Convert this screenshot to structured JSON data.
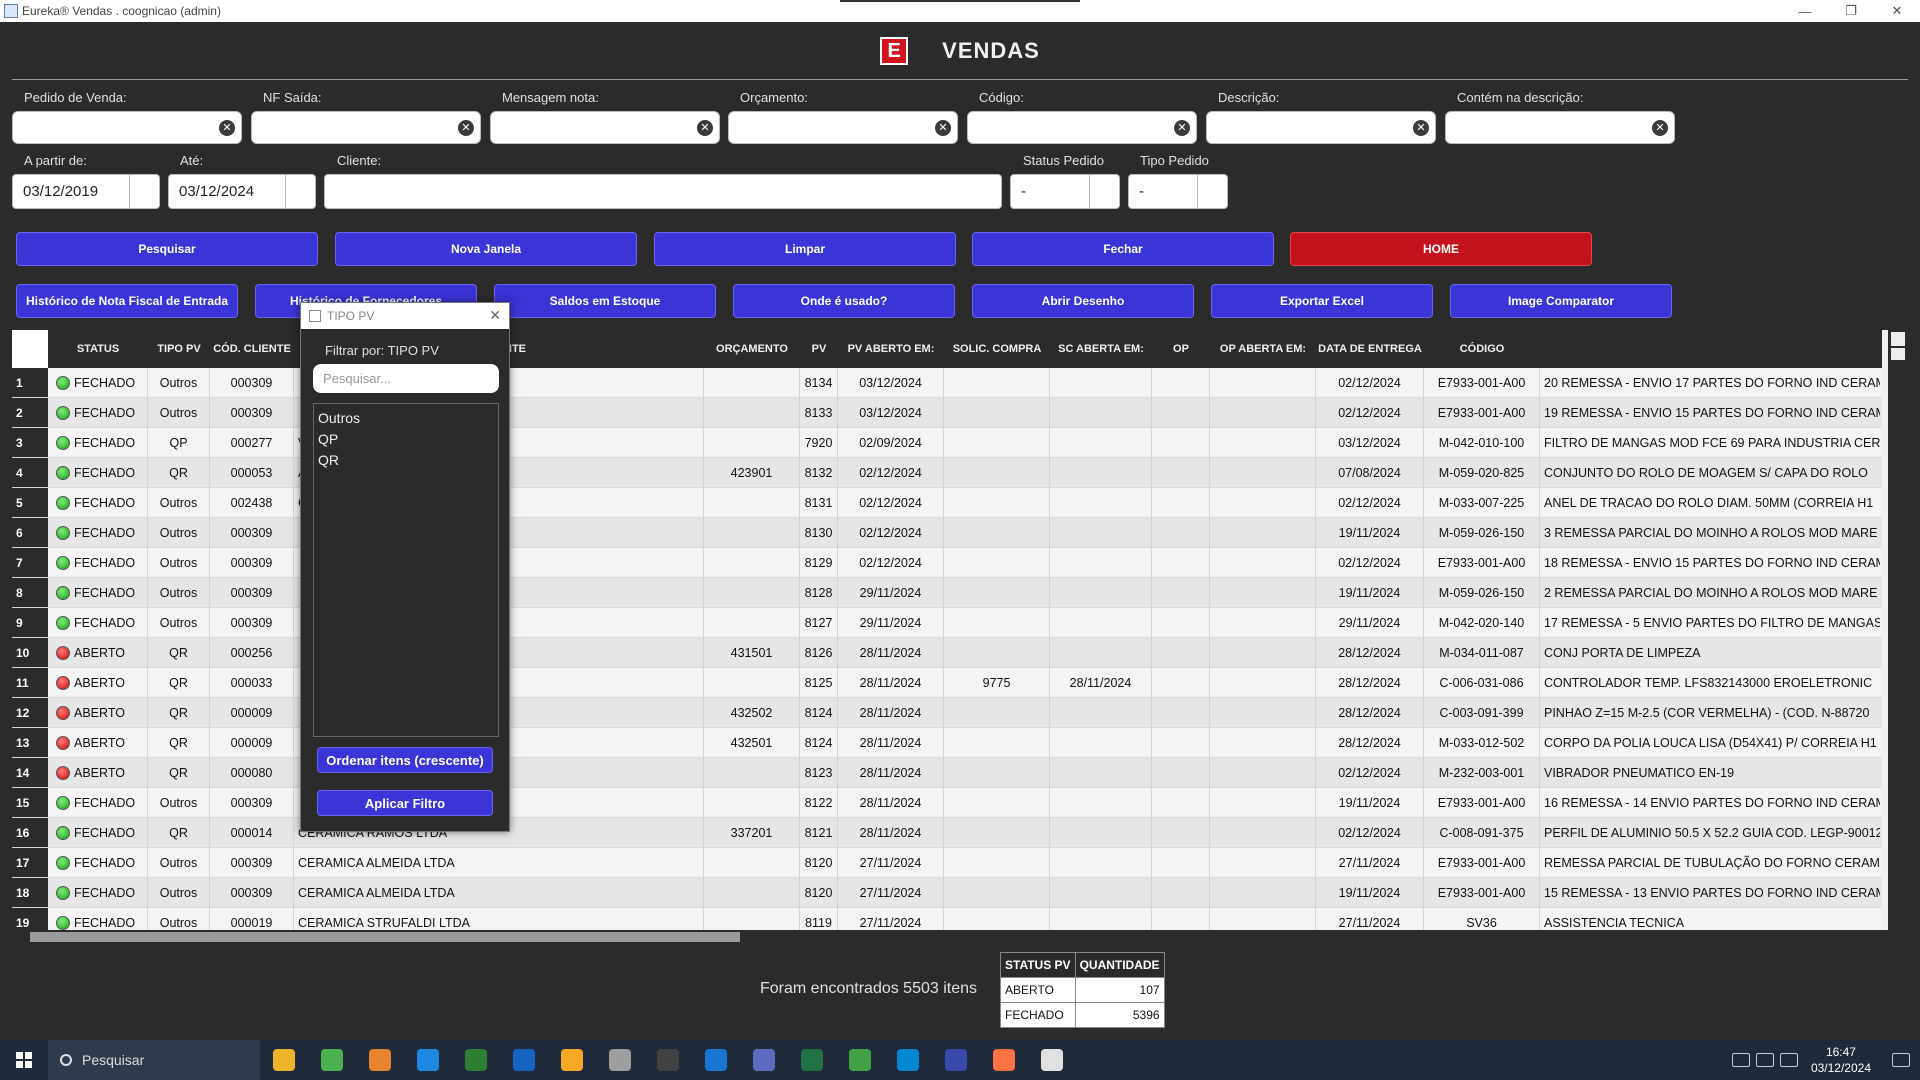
{
  "window": {
    "title": "Eureka® Vendas . coognicao (admin)",
    "minimize": "—",
    "restore": "❐",
    "close": "✕"
  },
  "header": {
    "logo": "E",
    "title": "VENDAS"
  },
  "filters": {
    "pedido_venda": "Pedido de Venda:",
    "nf_saida": "NF Saída:",
    "mensagem_nota": "Mensagem nota:",
    "orcamento": "Orçamento:",
    "codigo": "Código:",
    "descricao": "Descrição:",
    "contem_descricao": "Contém na descrição:",
    "a_partir_de": "A partir de:",
    "ate": "Até:",
    "cliente": "Cliente:",
    "status_pedido": "Status Pedido",
    "tipo_pedido": "Tipo Pedido",
    "date_from": "03/12/2019",
    "date_to": "03/12/2024",
    "status_value": "-",
    "tipo_value": "-"
  },
  "buttons": {
    "pesquisar": "Pesquisar",
    "nova_janela": "Nova Janela",
    "limpar": "Limpar",
    "fechar": "Fechar",
    "home": "HOME",
    "historico_nf": "Histórico de Nota Fiscal de Entrada",
    "historico_fornecedores": "Histórico de Fornecedores",
    "saldos": "Saldos em Estoque",
    "onde_usado": "Onde é usado?",
    "abrir_desenho": "Abrir Desenho",
    "exportar_excel": "Exportar Excel",
    "image_comparator": "Image Comparator"
  },
  "table": {
    "headers": {
      "status": "STATUS",
      "tipo_pv": "TIPO PV",
      "cod_cliente": "CÓD. CLIENTE",
      "cliente": "NTE",
      "orcamento": "ORÇAMENTO",
      "pv": "PV",
      "pv_aberto": "PV ABERTO EM:",
      "solic_compra": "SOLIC. COMPRA",
      "sc_aberta": "SC ABERTA EM:",
      "op": "OP",
      "op_aberta": "OP ABERTA EM:",
      "data_entrega": "DATA DE ENTREGA",
      "codigo": "CÓDIGO"
    },
    "rows": [
      {
        "n": "1",
        "status": "FECHADO",
        "color": "green",
        "tipo": "Outros",
        "cod": "000309",
        "cliente": "",
        "orc": "",
        "pv": "8134",
        "pvdate": "03/12/2024",
        "sc": "",
        "scdate": "",
        "op": "",
        "opdate": "",
        "entrega": "02/12/2024",
        "codigo": "E7933-001-A00",
        "desc": "20 REMESSA - ENVIO 17 PARTES DO FORNO IND CERAMICO"
      },
      {
        "n": "2",
        "status": "FECHADO",
        "color": "green",
        "tipo": "Outros",
        "cod": "000309",
        "cliente": "",
        "orc": "",
        "pv": "8133",
        "pvdate": "03/12/2024",
        "sc": "",
        "scdate": "",
        "op": "",
        "opdate": "",
        "entrega": "02/12/2024",
        "codigo": "E7933-001-A00",
        "desc": "19 REMESSA - ENVIO 15 PARTES DO FORNO IND CERAMICO"
      },
      {
        "n": "3",
        "status": "FECHADO",
        "color": "green",
        "tipo": "QP",
        "cod": "000277",
        "cliente": "VINILICOS LTDA",
        "orc": "",
        "pv": "7920",
        "pvdate": "02/09/2024",
        "sc": "",
        "scdate": "",
        "op": "",
        "opdate": "",
        "entrega": "03/12/2024",
        "codigo": "M-042-010-100",
        "desc": "FILTRO DE MANGAS MOD FCE 69 PARA INDUSTRIA CERAMICA"
      },
      {
        "n": "4",
        "status": "FECHADO",
        "color": "green",
        "tipo": "QR",
        "cod": "000053",
        "cliente": "AMICOS LTDA.",
        "orc": "423901",
        "pv": "8132",
        "pvdate": "02/12/2024",
        "sc": "",
        "scdate": "",
        "op": "",
        "opdate": "",
        "entrega": "07/08/2024",
        "codigo": "M-059-020-825",
        "desc": "CONJUNTO DO ROLO DE MOAGEM S/ CAPA DO ROLO"
      },
      {
        "n": "5",
        "status": "FECHADO",
        "color": "green",
        "tipo": "Outros",
        "cod": "002438",
        "cliente": "CO DE METAIS",
        "orc": "",
        "pv": "8131",
        "pvdate": "02/12/2024",
        "sc": "",
        "scdate": "",
        "op": "",
        "opdate": "",
        "entrega": "02/12/2024",
        "codigo": "M-033-007-225",
        "desc": "ANEL DE TRACAO DO ROLO DIAM. 50MM (CORREIA H1"
      },
      {
        "n": "6",
        "status": "FECHADO",
        "color": "green",
        "tipo": "Outros",
        "cod": "000309",
        "cliente": "",
        "orc": "",
        "pv": "8130",
        "pvdate": "02/12/2024",
        "sc": "",
        "scdate": "",
        "op": "",
        "opdate": "",
        "entrega": "19/11/2024",
        "codigo": "M-059-026-150",
        "desc": "3 REMESSA PARCIAL DO MOINHO A ROLOS MOD MARE"
      },
      {
        "n": "7",
        "status": "FECHADO",
        "color": "green",
        "tipo": "Outros",
        "cod": "000309",
        "cliente": "",
        "orc": "",
        "pv": "8129",
        "pvdate": "02/12/2024",
        "sc": "",
        "scdate": "",
        "op": "",
        "opdate": "",
        "entrega": "02/12/2024",
        "codigo": "E7933-001-A00",
        "desc": "18 REMESSA - ENVIO 15 PARTES DO FORNO IND CERAMICO"
      },
      {
        "n": "8",
        "status": "FECHADO",
        "color": "green",
        "tipo": "Outros",
        "cod": "000309",
        "cliente": "",
        "orc": "",
        "pv": "8128",
        "pvdate": "29/11/2024",
        "sc": "",
        "scdate": "",
        "op": "",
        "opdate": "",
        "entrega": "19/11/2024",
        "codigo": "M-059-026-150",
        "desc": "2 REMESSA PARCIAL DO MOINHO A ROLOS MOD MARE"
      },
      {
        "n": "9",
        "status": "FECHADO",
        "color": "green",
        "tipo": "Outros",
        "cod": "000309",
        "cliente": "",
        "orc": "",
        "pv": "8127",
        "pvdate": "29/11/2024",
        "sc": "",
        "scdate": "",
        "op": "",
        "opdate": "",
        "entrega": "29/11/2024",
        "codigo": "M-042-020-140",
        "desc": "17 REMESSA - 5 ENVIO PARTES DO FILTRO DE MANGAS"
      },
      {
        "n": "10",
        "status": "ABERTO",
        "color": "red",
        "tipo": "QR",
        "cod": "000256",
        "cliente": "",
        "orc": "431501",
        "pv": "8126",
        "pvdate": "28/11/2024",
        "sc": "",
        "scdate": "",
        "op": "",
        "opdate": "",
        "entrega": "28/12/2024",
        "codigo": "M-034-011-087",
        "desc": "CONJ PORTA DE LIMPEZA"
      },
      {
        "n": "11",
        "status": "ABERTO",
        "color": "red",
        "tipo": "QR",
        "cod": "000033",
        "cliente": "",
        "orc": "",
        "pv": "8125",
        "pvdate": "28/11/2024",
        "sc": "9775",
        "scdate": "28/11/2024",
        "op": "",
        "opdate": "",
        "entrega": "28/12/2024",
        "codigo": "C-006-031-086",
        "desc": "CONTROLADOR TEMP. LFS832143000 EROELETRONIC"
      },
      {
        "n": "12",
        "status": "ABERTO",
        "color": "red",
        "tipo": "QR",
        "cod": "000009",
        "cliente": "",
        "orc": "432502",
        "pv": "8124",
        "pvdate": "28/11/2024",
        "sc": "",
        "scdate": "",
        "op": "",
        "opdate": "",
        "entrega": "28/12/2024",
        "codigo": "C-003-091-399",
        "desc": "PINHAO Z=15 M-2.5 (COR VERMELHA) - (COD. N-88720"
      },
      {
        "n": "13",
        "status": "ABERTO",
        "color": "red",
        "tipo": "QR",
        "cod": "000009",
        "cliente": "",
        "orc": "432501",
        "pv": "8124",
        "pvdate": "28/11/2024",
        "sc": "",
        "scdate": "",
        "op": "",
        "opdate": "",
        "entrega": "28/12/2024",
        "codigo": "M-033-012-502",
        "desc": "CORPO DA POLIA LOUCA LISA (D54X41) P/ CORREIA H1"
      },
      {
        "n": "14",
        "status": "ABERTO",
        "color": "red",
        "tipo": "QR",
        "cod": "000080",
        "cliente": "",
        "orc": "",
        "pv": "8123",
        "pvdate": "28/11/2024",
        "sc": "",
        "scdate": "",
        "op": "",
        "opdate": "",
        "entrega": "02/12/2024",
        "codigo": "M-232-003-001",
        "desc": "VIBRADOR PNEUMATICO EN-19"
      },
      {
        "n": "15",
        "status": "FECHADO",
        "color": "green",
        "tipo": "Outros",
        "cod": "000309",
        "cliente": "",
        "orc": "",
        "pv": "8122",
        "pvdate": "28/11/2024",
        "sc": "",
        "scdate": "",
        "op": "",
        "opdate": "",
        "entrega": "19/11/2024",
        "codigo": "E7933-001-A00",
        "desc": "16 REMESSA - 14 ENVIO PARTES DO FORNO IND CERAMICO"
      },
      {
        "n": "16",
        "status": "FECHADO",
        "color": "green",
        "tipo": "QR",
        "cod": "000014",
        "cliente": "CERAMICA RAMOS LTDA",
        "orc": "337201",
        "pv": "8121",
        "pvdate": "28/11/2024",
        "sc": "",
        "scdate": "",
        "op": "",
        "opdate": "",
        "entrega": "02/12/2024",
        "codigo": "C-008-091-375",
        "desc": "PERFIL DE ALUMINIO 50.5 X 52.2 GUIA COD. LEGP-90012"
      },
      {
        "n": "17",
        "status": "FECHADO",
        "color": "green",
        "tipo": "Outros",
        "cod": "000309",
        "cliente": "CERAMICA ALMEIDA LTDA",
        "orc": "",
        "pv": "8120",
        "pvdate": "27/11/2024",
        "sc": "",
        "scdate": "",
        "op": "",
        "opdate": "",
        "entrega": "27/11/2024",
        "codigo": "E7933-001-A00",
        "desc": "REMESSA PARCIAL DE TUBULAÇÃO DO FORNO CERAMICO"
      },
      {
        "n": "18",
        "status": "FECHADO",
        "color": "green",
        "tipo": "Outros",
        "cod": "000309",
        "cliente": "CERAMICA ALMEIDA LTDA",
        "orc": "",
        "pv": "8120",
        "pvdate": "27/11/2024",
        "sc": "",
        "scdate": "",
        "op": "",
        "opdate": "",
        "entrega": "19/11/2024",
        "codigo": "E7933-001-A00",
        "desc": "15 REMESSA - 13 ENVIO PARTES DO FORNO IND CERAMICO"
      },
      {
        "n": "19",
        "status": "FECHADO",
        "color": "green",
        "tipo": "Outros",
        "cod": "000019",
        "cliente": "CERAMICA STRUFALDI LTDA",
        "orc": "",
        "pv": "8119",
        "pvdate": "27/11/2024",
        "sc": "",
        "scdate": "",
        "op": "",
        "opdate": "",
        "entrega": "27/11/2024",
        "codigo": "SV36",
        "desc": "ASSISTENCIA TECNICA"
      }
    ]
  },
  "popup": {
    "title": "TIPO PV",
    "close": "✕",
    "filter_label": "Filtrar por: TIPO PV",
    "search_placeholder": "Pesquisar...",
    "items": [
      "Outros",
      "QP",
      "QR"
    ],
    "sort_button": "Ordenar itens (crescente)",
    "apply_button": "Aplicar Filtro"
  },
  "footer": {
    "found": "Foram encontrados 5503 itens",
    "summary_headers": [
      "STATUS PV",
      "QUANTIDADE"
    ],
    "summary_rows": [
      [
        "ABERTO",
        "107"
      ],
      [
        "FECHADO",
        "5396"
      ]
    ]
  },
  "taskbar": {
    "search": "Pesquisar",
    "time": "16:47",
    "date": "03/12/2024",
    "icon_colors": [
      "#f0b429",
      "#4caf50",
      "#e8832f",
      "#1e88e5",
      "#2e7d32",
      "#1565c0",
      "#f9a825",
      "#9e9e9e",
      "#424242",
      "#1976d2",
      "#5c6bc0",
      "#217346",
      "#43a047",
      "#0288d1",
      "#3949ab",
      "#ff7043",
      "#e0e0e0"
    ]
  }
}
